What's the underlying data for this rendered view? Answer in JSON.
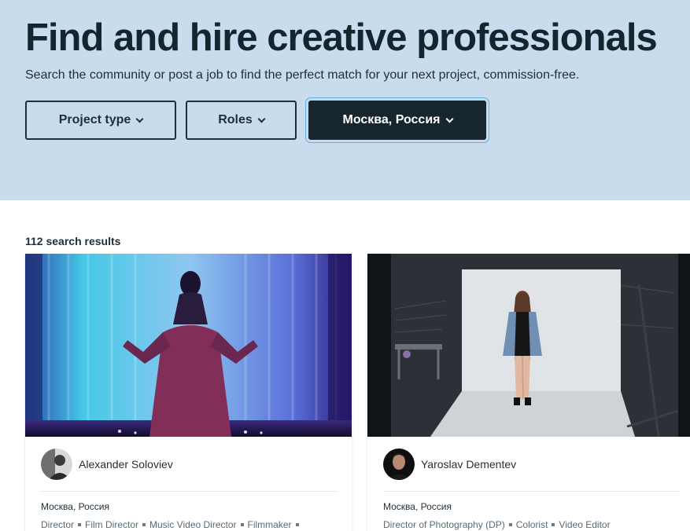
{
  "hero": {
    "title": "Find and hire creative professionals",
    "subtitle": "Search the community or post a job to find the perfect match for your next project, commission-free."
  },
  "filters": [
    {
      "label": "Project type",
      "active": false
    },
    {
      "label": "Roles",
      "active": false
    },
    {
      "label": "Москва, Россия",
      "active": true
    }
  ],
  "results": {
    "count_label": "112 search results"
  },
  "cards": [
    {
      "name": "Alexander Soloviev",
      "location": "Москва, Россия",
      "roles": [
        "Director",
        "Film Director",
        "Music Video Director",
        "Filmmaker"
      ],
      "trailing_separator": true
    },
    {
      "name": "Yaroslav Dementev",
      "location": "Москва, Россия",
      "roles": [
        "Director of Photography (DP)",
        "Colorist",
        "Video Editor"
      ],
      "trailing_separator": false
    }
  ],
  "colors": {
    "hero_bg": "#c9dced",
    "active_filter_bg": "#16252e",
    "focus_ring": "#5bb3e8",
    "text_primary": "#1f2e38",
    "text_muted": "#5a6a75"
  }
}
